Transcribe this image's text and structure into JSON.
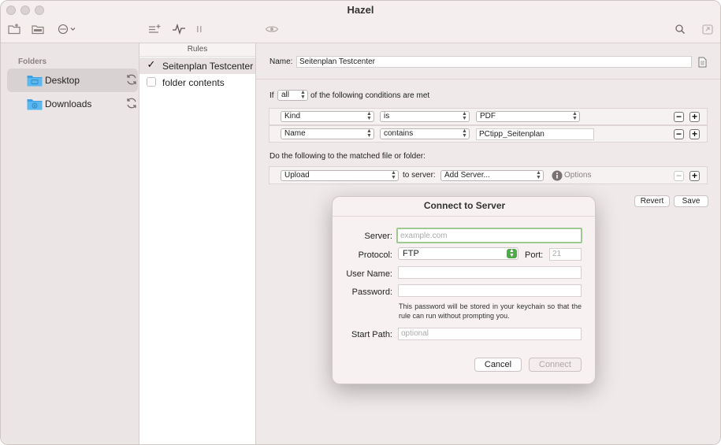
{
  "window": {
    "title": "Hazel"
  },
  "folders": {
    "label": "Folders",
    "items": [
      {
        "name": "Desktop",
        "selected": true
      },
      {
        "name": "Downloads",
        "selected": false
      }
    ]
  },
  "rules": {
    "header": "Rules",
    "items": [
      {
        "name": "Seitenplan Testcenter",
        "checked": true
      },
      {
        "name": "folder contents",
        "checked": false
      }
    ]
  },
  "editor": {
    "name_label": "Name:",
    "name_value": "Seitenplan Testcenter",
    "if_label": "If",
    "match_select": "all",
    "conditions_text": "of the following conditions are met",
    "conditions": [
      {
        "attribute": "Kind",
        "operator": "is",
        "value": "PDF"
      },
      {
        "attribute": "Name",
        "operator": "contains",
        "value": "PCtipp_Seitenplan"
      }
    ],
    "actions_label": "Do the following to the matched file or folder:",
    "action": {
      "type": "Upload",
      "to_label": "to server:",
      "server": "Add Server...",
      "options": "Options"
    },
    "revert_label": "Revert",
    "save_label": "Save"
  },
  "dialog": {
    "title": "Connect to Server",
    "server_label": "Server:",
    "server_placeholder": "example.com",
    "protocol_label": "Protocol:",
    "protocol_value": "FTP",
    "port_label": "Port:",
    "port_placeholder": "21",
    "username_label": "User Name:",
    "password_label": "Password:",
    "password_note": "This password will be stored in your keychain so that the rule can run without prompting you.",
    "startpath_label": "Start Path:",
    "startpath_placeholder": "optional",
    "cancel_label": "Cancel",
    "connect_label": "Connect"
  },
  "colors": {
    "accent_green": "#4eaa48",
    "folder_blue": "#3aa0e0",
    "focus_ring": "#9ec98f"
  }
}
